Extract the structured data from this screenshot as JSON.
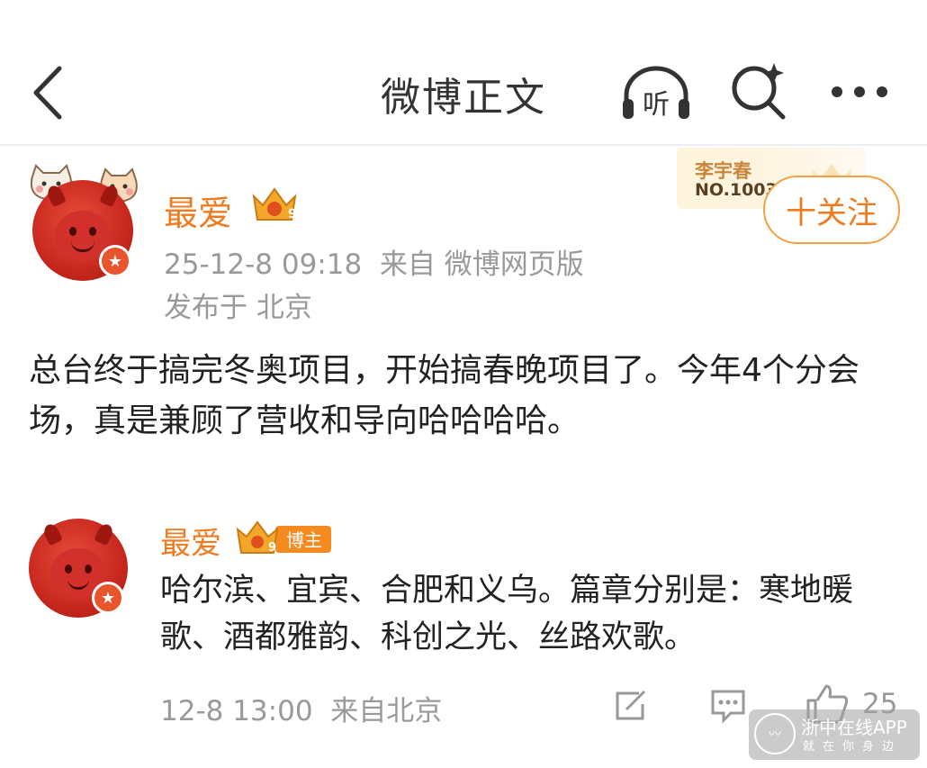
{
  "header": {
    "title": "微博正文",
    "listen_label": "听"
  },
  "post": {
    "author": "最爱",
    "time": "25-12-8 09:18",
    "source": "来自 微博网页版",
    "location": "发布于 北京",
    "fan_card": {
      "name": "李宇春",
      "number": "NO.1003"
    },
    "follow_label": "十关注",
    "text": "总台终于搞完冬奥项目，开始搞春晚项目了。今年4个分会场，真是兼顾了营收和导向哈哈哈哈。",
    "level": "9"
  },
  "comment": {
    "author": "最爱",
    "level": "9",
    "role_badge": "博主",
    "text": "哈尔滨、宜宾、合肥和义乌。篇章分别是：寒地暖歌、酒都雅韵、科创之光、丝路欢歌。",
    "time": "12-8 13:00",
    "location": "来自北京",
    "like_count": "25"
  },
  "watermark": {
    "title": "浙中在线APP",
    "subtitle": "就在你身边"
  },
  "colors": {
    "accent": "#f07a1e",
    "meta": "#999999",
    "avatar": "#c8281e"
  }
}
